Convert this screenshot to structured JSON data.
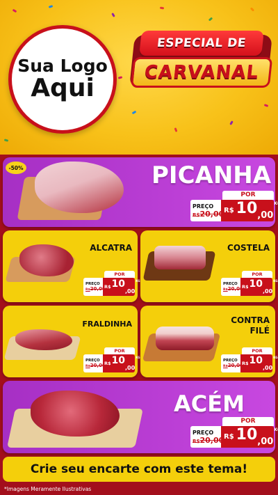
{
  "header": {
    "logo_line1": "Sua Logo",
    "logo_line2": "Aqui",
    "badge_top": "ESPECIAL DE",
    "badge_bottom": "CARVANAL"
  },
  "colors": {
    "brand_red": "#c8101b",
    "brand_yellow": "#f4cf0b",
    "card_purple": "#b43cd2",
    "background_dark_red": "#a30f1c"
  },
  "discount_badge": "-50%",
  "price_labels": {
    "por": "POR",
    "preco": "PREÇO",
    "currency": "R$",
    "unit": "KG"
  },
  "products": [
    {
      "name": "PICANHA",
      "old_price_prefix": "R$",
      "old_price": "20,00",
      "price_int": "10",
      "price_dec": ",00"
    },
    {
      "name": "ALCATRA",
      "old_price_prefix": "R$",
      "old_price": "20,00",
      "price_int": "10",
      "price_dec": ",00"
    },
    {
      "name_line1": "COSTELA",
      "old_price_prefix": "R$",
      "old_price": "20,00",
      "price_int": "10",
      "price_dec": ",00"
    },
    {
      "name": "FRALDINHA",
      "old_price_prefix": "R$",
      "old_price": "20,00",
      "price_int": "10",
      "price_dec": ",00"
    },
    {
      "name_line1": "CONTRA",
      "name_line2": "FILÉ",
      "old_price_prefix": "R$",
      "old_price": "20,00",
      "price_int": "10",
      "price_dec": ",00"
    },
    {
      "name": "ACÉM",
      "old_price_prefix": "R$",
      "old_price": "20,00",
      "price_int": "10",
      "price_dec": ",00"
    }
  ],
  "cta": "Crie seu encarte com este tema!",
  "footnote": "*Imagens Meramente Ilustrativas"
}
